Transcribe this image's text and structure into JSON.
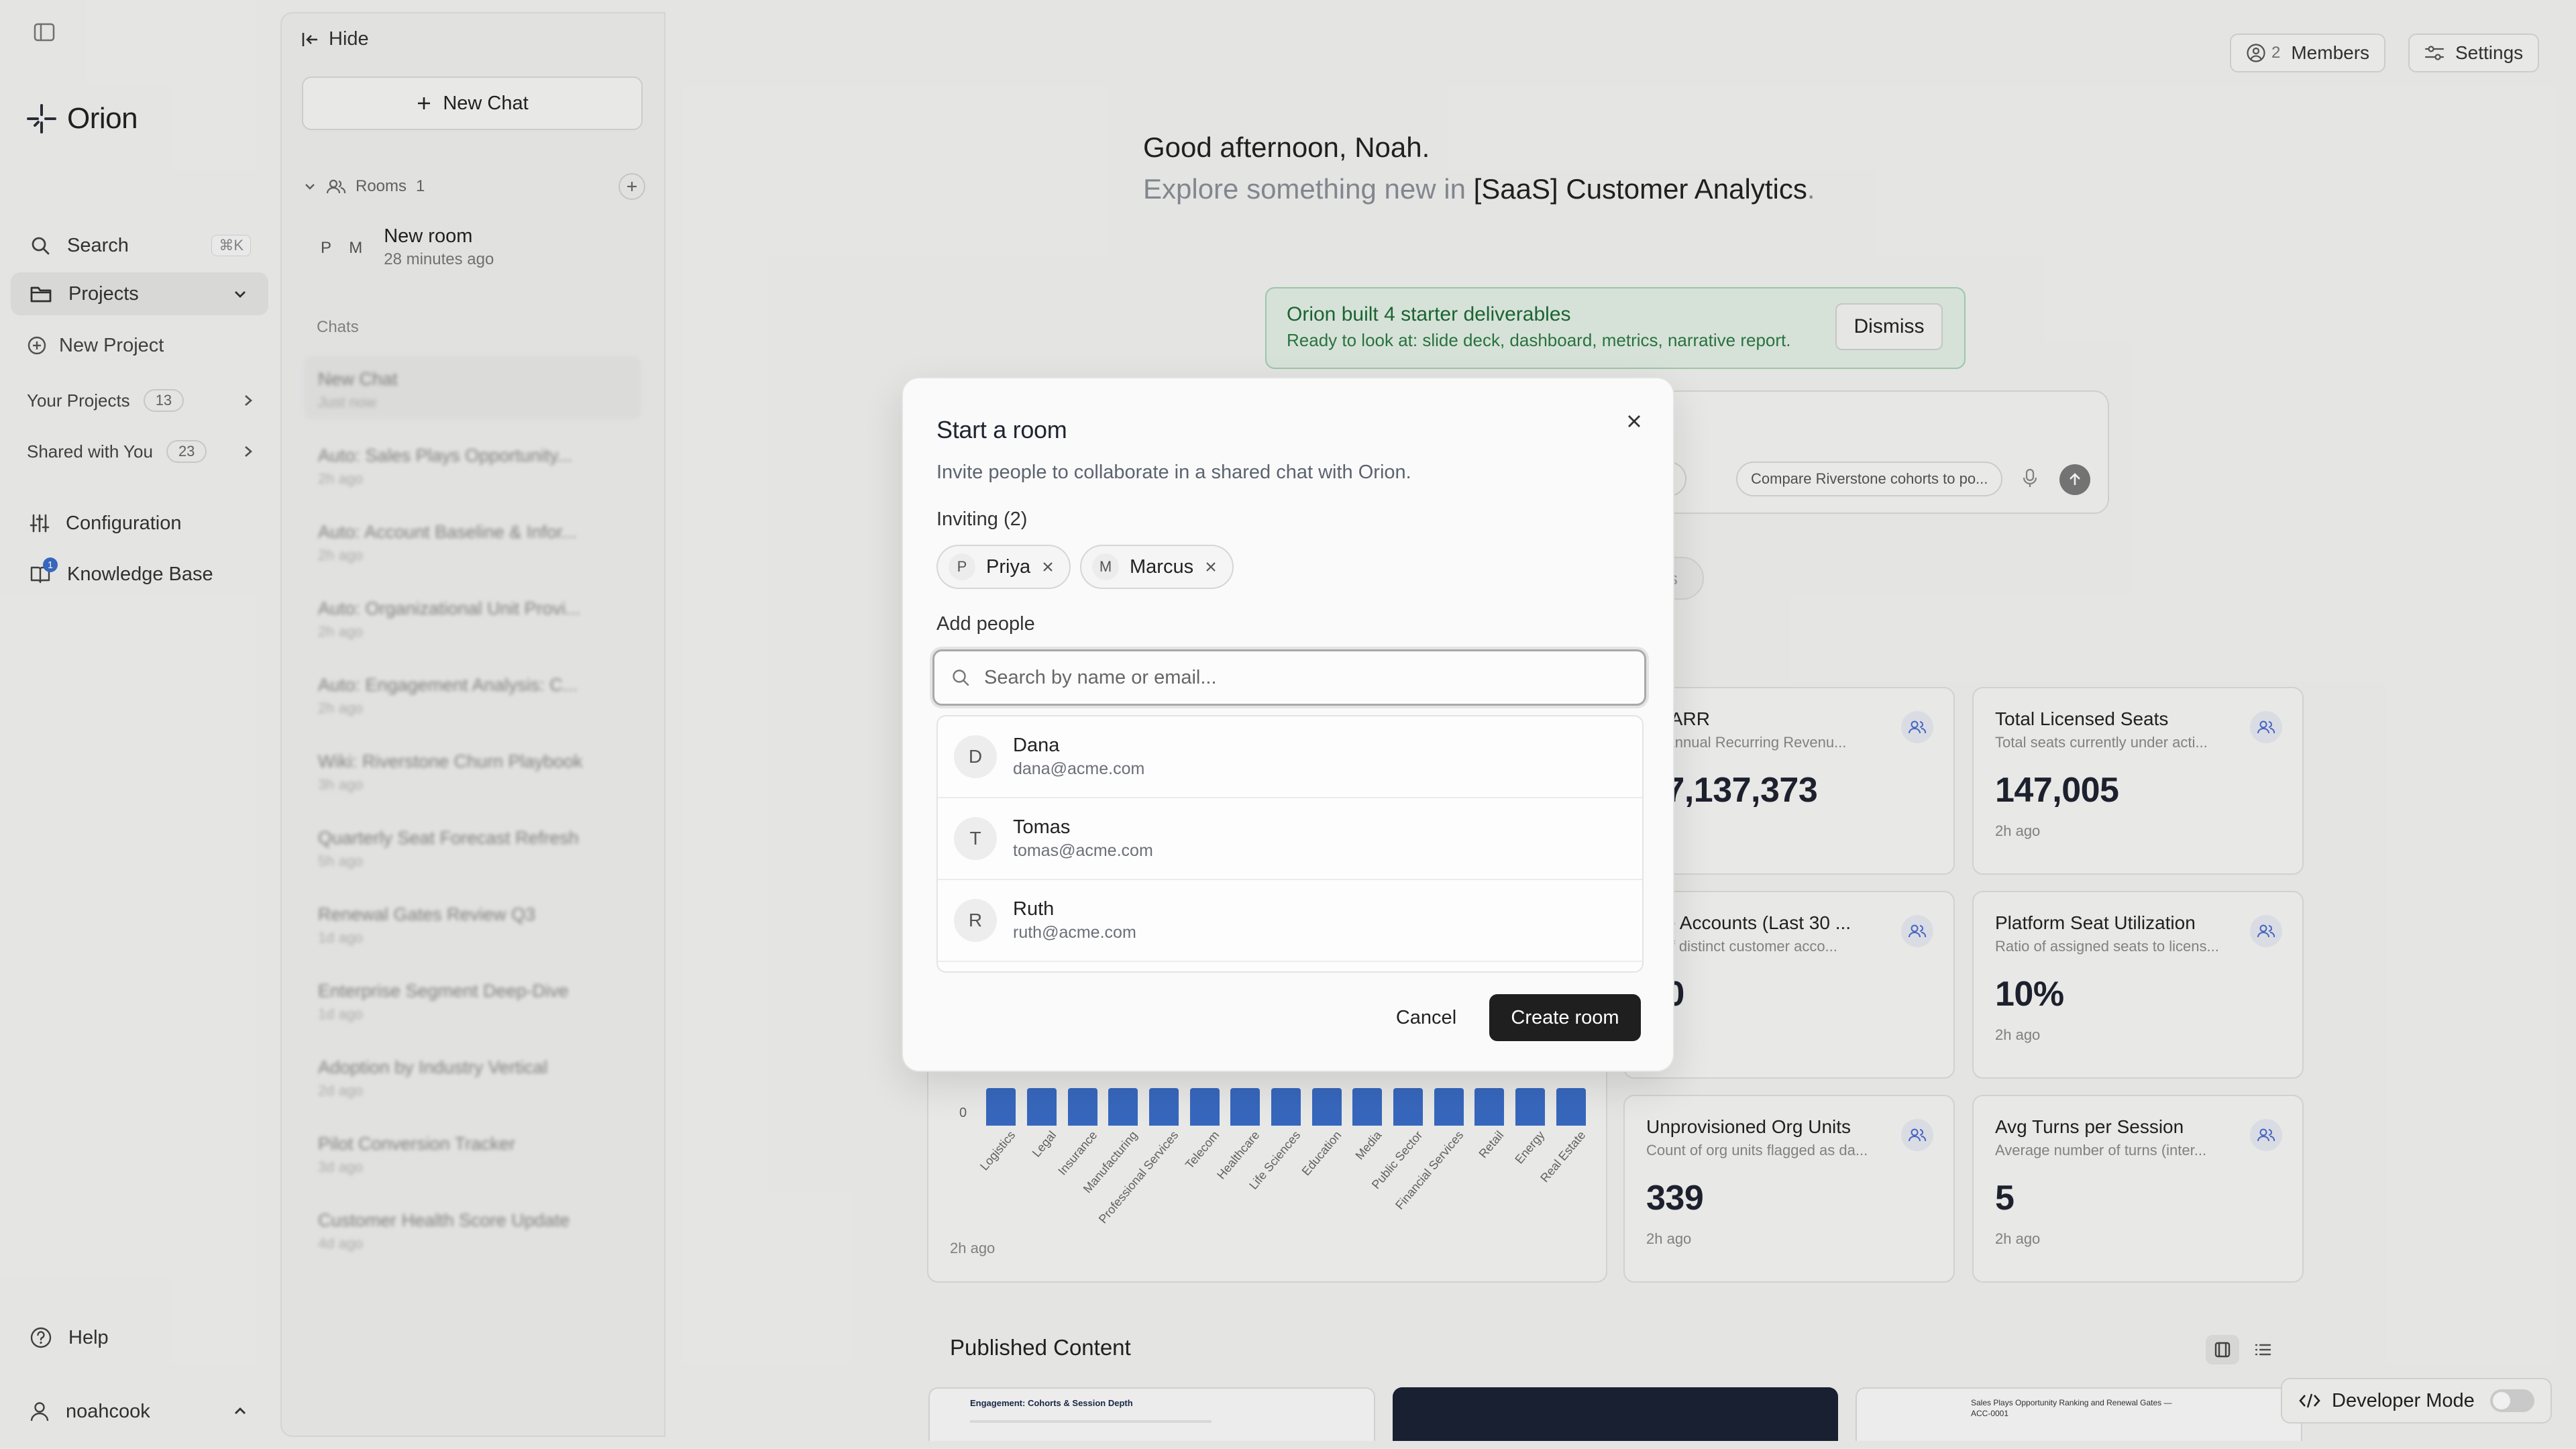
{
  "rail": {
    "brand": "Orion",
    "search_label": "Search",
    "search_shortcut": "⌘K",
    "projects_label": "Projects",
    "new_project_label": "New Project",
    "your_projects": {
      "label": "Your Projects",
      "count": "13"
    },
    "shared_with_you": {
      "label": "Shared with You",
      "count": "23"
    },
    "configuration_label": "Configuration",
    "knowledge_base_label": "Knowledge Base",
    "knowledge_base_badge": "1",
    "help_label": "Help",
    "user_label": "noahcook"
  },
  "panel": {
    "hide_label": "Hide",
    "new_chat_label": "New Chat",
    "rooms_label": "Rooms",
    "rooms_count": "1",
    "room": {
      "avatars": "P M",
      "name": "New room",
      "time": "28 minutes ago"
    },
    "chats_label": "Chats",
    "chats": [
      {
        "title": "New Chat",
        "time": "Just now"
      },
      {
        "title": "Auto: Sales Plays Opportunity...",
        "time": "2h ago"
      },
      {
        "title": "Auto: Account Baseline & Infor...",
        "time": "2h ago"
      },
      {
        "title": "Auto: Organizational Unit Provi...",
        "time": "2h ago"
      },
      {
        "title": "Auto: Engagement Analysis: C...",
        "time": "2h ago"
      },
      {
        "title": "Wiki: Riverstone Churn Playbook",
        "time": "3h ago"
      },
      {
        "title": "Quarterly Seat Forecast Refresh",
        "time": "5h ago"
      },
      {
        "title": "Renewal Gates Review Q3",
        "time": "1d ago"
      },
      {
        "title": "Enterprise Segment Deep-Dive",
        "time": "1d ago"
      },
      {
        "title": "Adoption by Industry Vertical",
        "time": "2d ago"
      },
      {
        "title": "Pilot Conversion Tracker",
        "time": "3d ago"
      },
      {
        "title": "Customer Health Score Update",
        "time": "4d ago"
      }
    ]
  },
  "main": {
    "members_count": "2",
    "members_label": "Members",
    "settings_label": "Settings",
    "greeting": "Good afternoon, Noah.",
    "explore_prefix": "Explore something new in",
    "project_name": "[SaaS] Customer Analytics",
    "explore_suffix": ".",
    "notice": {
      "title": "Orion built 4 starter deliverables",
      "body": "Ready to look at: slide deck, dashboard, metrics, narrative report.",
      "dismiss": "Dismiss"
    },
    "suggestions": [
      "units",
      "Compare Riverstone cohorts to po..."
    ],
    "tab_stub": "rs",
    "metrics": [
      {
        "title": "tal ARR",
        "desc": "tal Annual Recurring Revenu...",
        "value": "47,137,373",
        "age": "ago"
      },
      {
        "title": "Total Licensed Seats",
        "desc": "Total seats currently under acti...",
        "value": "147,005",
        "age": "2h ago"
      },
      {
        "title": "tive Accounts (Last 30 ...",
        "desc": "nt of distinct customer acco...",
        "value": "60",
        "age": "ago"
      },
      {
        "title": "Platform Seat Utilization",
        "desc": "Ratio of assigned seats to licens...",
        "value": "10%",
        "age": "2h ago"
      },
      {
        "title": "Unprovisioned Org Units",
        "desc": "Count of org units flagged as da...",
        "value": "339",
        "age": "2h ago"
      },
      {
        "title": "Avg Turns per Session",
        "desc": "Average number of turns (inter...",
        "value": "5",
        "age": "2h ago"
      }
    ],
    "chart_age": "2h ago",
    "published_title": "Published Content",
    "thumbs": [
      {
        "title": "Engagement: Cohorts & Session Depth"
      },
      {
        "title": ""
      },
      {
        "title": "Sales Plays Opportunity Ranking and Renewal Gates — ACC-0001"
      }
    ],
    "developer_mode_label": "Developer Mode"
  },
  "chart_data": {
    "type": "bar",
    "categories": [
      "Logistics",
      "Legal",
      "Insurance",
      "Manufacturing",
      "Professional Services",
      "Telecom",
      "Healthcare",
      "Life Sciences",
      "Education",
      "Media",
      "Public Sector",
      "Financial Services",
      "Retail",
      "Energy",
      "Real Estate"
    ],
    "values": [
      1,
      1,
      1,
      1,
      1,
      1,
      1,
      1,
      1,
      1,
      1,
      1,
      1,
      1,
      1
    ],
    "visible_ytick": "0",
    "title": "",
    "xlabel": "",
    "ylabel": "",
    "colors": {
      "bar": "#3b6ec9"
    }
  },
  "modal": {
    "title": "Start a room",
    "description": "Invite people to collaborate in a shared chat with Orion.",
    "inviting_label": "Inviting (2)",
    "invited": [
      {
        "initial": "P",
        "name": "Priya"
      },
      {
        "initial": "M",
        "name": "Marcus"
      }
    ],
    "add_people_label": "Add people",
    "search_placeholder": "Search by name or email...",
    "search_value": "",
    "people": [
      {
        "initial": "D",
        "name": "Dana",
        "email": "dana@acme.com"
      },
      {
        "initial": "T",
        "name": "Tomas",
        "email": "tomas@acme.com"
      },
      {
        "initial": "R",
        "name": "Ruth",
        "email": "ruth@acme.com"
      }
    ],
    "cancel_label": "Cancel",
    "create_label": "Create room"
  }
}
